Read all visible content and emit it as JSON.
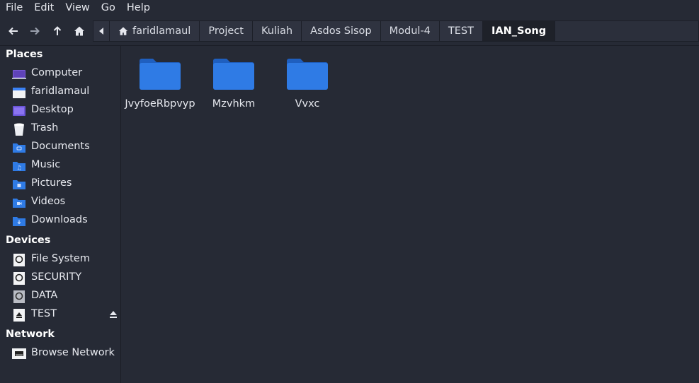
{
  "menubar": {
    "items": [
      "File",
      "Edit",
      "View",
      "Go",
      "Help"
    ]
  },
  "toolbar": {
    "icons": [
      "back-arrow-icon",
      "forward-arrow-icon",
      "up-arrow-icon",
      "home-icon"
    ]
  },
  "breadcrumbs": {
    "items": [
      "faridlamaul",
      "Project",
      "Kuliah",
      "Asdos Sisop",
      "Modul-4",
      "TEST",
      "IAN_Song"
    ],
    "active_index": 6
  },
  "sidebar": {
    "places": {
      "heading": "Places",
      "items": [
        "Computer",
        "faridlamaul",
        "Desktop",
        "Trash",
        "Documents",
        "Music",
        "Pictures",
        "Videos",
        "Downloads"
      ]
    },
    "devices": {
      "heading": "Devices",
      "items": [
        "File System",
        "SECURITY",
        "DATA",
        "TEST"
      ]
    },
    "network": {
      "heading": "Network",
      "items": [
        "Browse Network"
      ]
    }
  },
  "main": {
    "folders": [
      "JvyfoeRbpvyp",
      "Mzvhkm",
      "Vvxc"
    ]
  },
  "colors": {
    "background": "#262a35",
    "folder_blue": "#2f7be5",
    "accent": "#3b82f6"
  }
}
